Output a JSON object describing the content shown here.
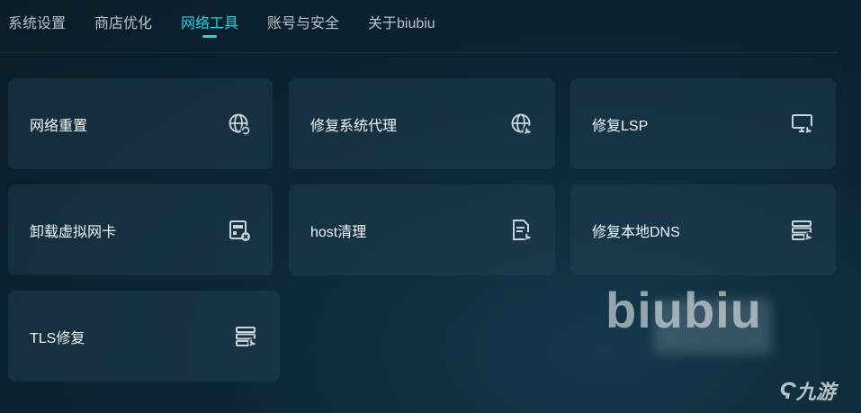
{
  "tabs": [
    {
      "label": "系统设置"
    },
    {
      "label": "商店优化"
    },
    {
      "label": "网络工具"
    },
    {
      "label": "账号与安全"
    },
    {
      "label": "关于biubiu"
    }
  ],
  "cards": [
    {
      "label": "网络重置",
      "icon": "globe-refresh-icon"
    },
    {
      "label": "修复系统代理",
      "icon": "globe-wrench-icon"
    },
    {
      "label": "修复LSP",
      "icon": "monitor-wrench-icon"
    },
    {
      "label": "卸载虚拟网卡",
      "icon": "network-card-remove-icon"
    },
    {
      "label": "host清理",
      "icon": "document-wrench-icon"
    },
    {
      "label": "修复本地DNS",
      "icon": "server-wrench-icon"
    },
    {
      "label": "TLS修复",
      "icon": "server-wrench-icon"
    }
  ],
  "brand": {
    "text": "biubiu"
  },
  "watermark": {
    "text": "九游"
  },
  "colors": {
    "accent": "#27d3e6",
    "card": "#1c3444",
    "background": "#0d2636"
  }
}
